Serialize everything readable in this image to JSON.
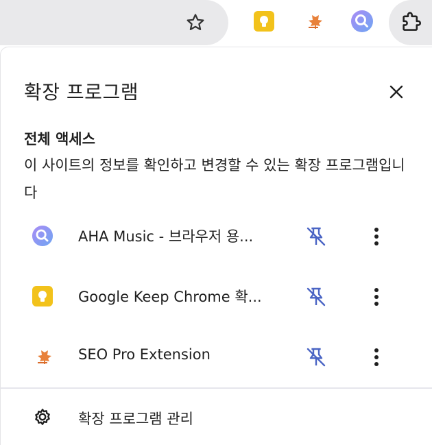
{
  "toolbar": {
    "icons": [
      "star-icon",
      "google-keep-icon",
      "seo-pro-icon",
      "aha-music-icon",
      "extensions-puzzle-icon"
    ]
  },
  "panel": {
    "title": "확장 프로그램",
    "section_title": "전체 액세스",
    "section_description": "이 사이트의 정보를 확인하고 변경할 수 있는 확장 프로그램입니다",
    "extensions": [
      {
        "name": "AHA Music - 브라우저 용...",
        "icon": "aha-music-icon",
        "pinned": false
      },
      {
        "name": "Google Keep Chrome 확...",
        "icon": "google-keep-icon",
        "pinned": false
      },
      {
        "name": "SEO Pro Extension",
        "icon": "seo-pro-icon",
        "pinned": false
      }
    ],
    "manage_label": "확장 프로그램 관리"
  },
  "colors": {
    "pin_icon": "#4a64c4",
    "keep_yellow": "#f2c21b",
    "seo_orange": "#e8813a",
    "aha_purple": "#8b8ff0",
    "toolbar_bg": "#e9e9eb"
  }
}
